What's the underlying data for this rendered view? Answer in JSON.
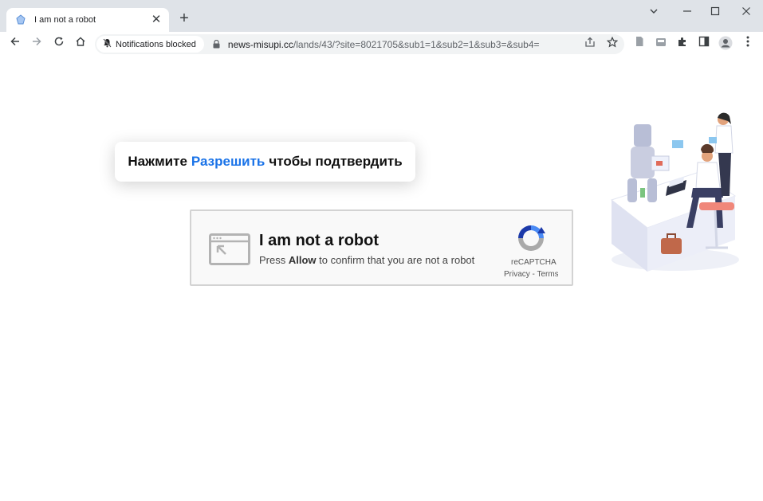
{
  "browser": {
    "tab": {
      "title": "I am not a robot"
    },
    "address_bar": {
      "notification_chip": "Notifications blocked",
      "url_host": "news-misupi.cc",
      "url_path": "/lands/43/?site=8021705&sub1=1&sub2=1&sub3=&sub4="
    }
  },
  "page": {
    "tooltip": {
      "before": "Нажмите",
      "highlight": "Разрешить",
      "after": "чтобы подтвердить",
      "highlight_color": "#1a73e8"
    },
    "captcha": {
      "title": "I am not a robot",
      "subtitle_before": "Press",
      "subtitle_bold": "Allow",
      "subtitle_after": "to confirm that you are not a robot",
      "brand": "reCAPTCHA",
      "links": "Privacy - Terms"
    }
  },
  "icons": [
    "favicon-icon",
    "close-icon",
    "new-tab-icon",
    "chevron-down-icon",
    "minimize-icon",
    "maximize-icon",
    "window-close-icon",
    "back-icon",
    "forward-icon",
    "reload-icon",
    "home-icon",
    "bell-off-icon",
    "lock-icon",
    "share-icon",
    "star-icon",
    "document-icon",
    "inbox-icon",
    "extensions-icon",
    "sidepanel-icon",
    "profile-icon",
    "menu-icon",
    "browser-window-icon",
    "recaptcha-icon"
  ]
}
